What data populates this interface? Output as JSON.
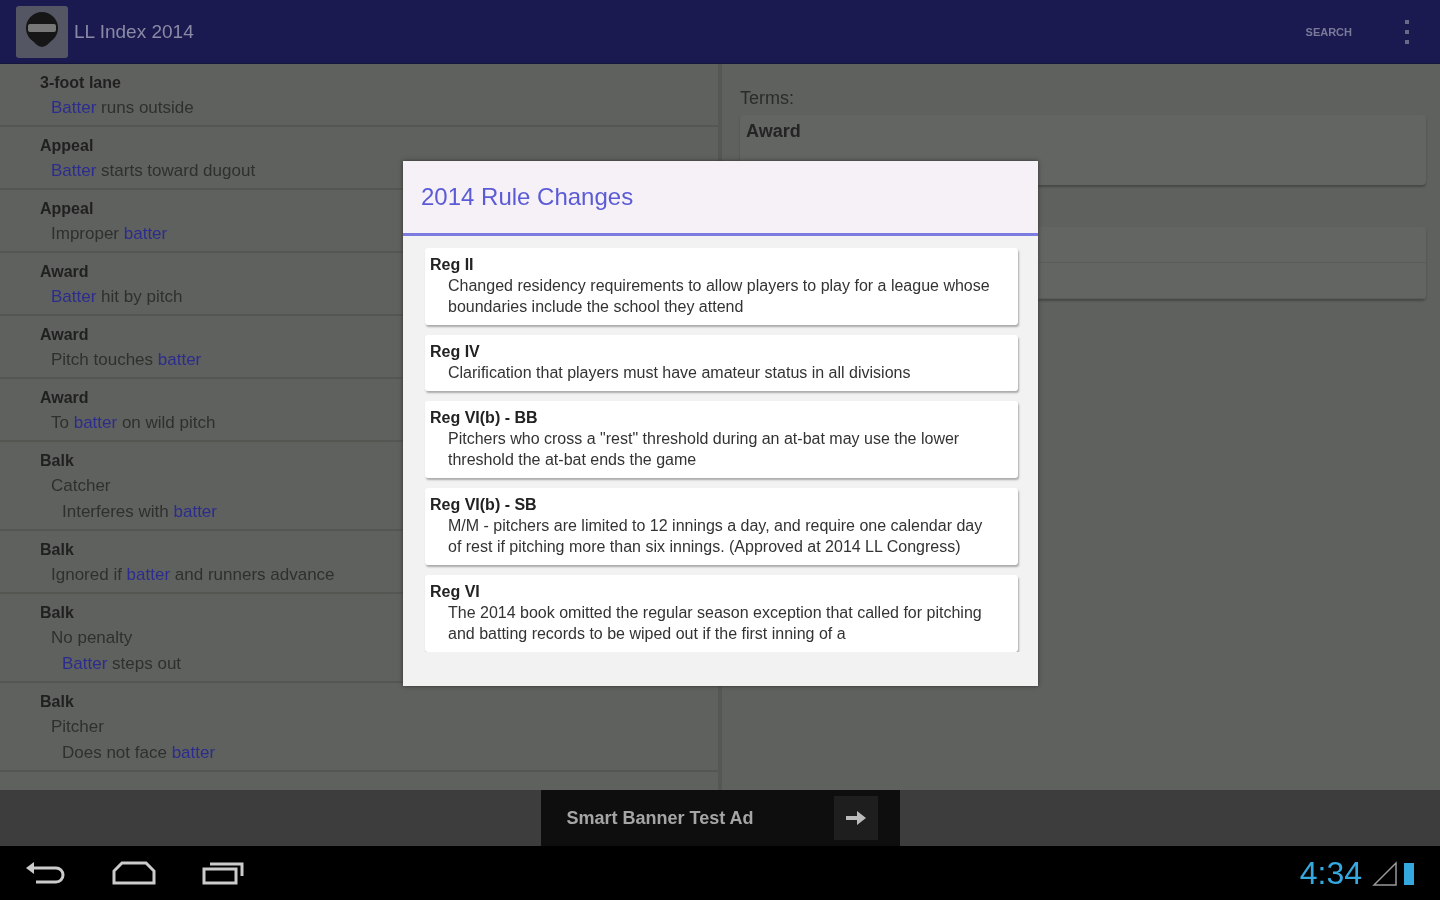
{
  "app_bar": {
    "title": "LL Index 2014",
    "actions": [
      {
        "kind": "text",
        "label": "SEARCH"
      },
      {
        "kind": "overflow"
      }
    ]
  },
  "index": [
    {
      "term": "3-foot lane",
      "children": [
        {
          "segments": [
            {
              "text": "Batter",
              "highlight": true
            },
            {
              "text": " runs outside",
              "highlight": false
            }
          ]
        }
      ]
    },
    {
      "term": "Appeal",
      "children": [
        {
          "segments": [
            {
              "text": "Batter",
              "highlight": true
            },
            {
              "text": " starts toward dugout",
              "highlight": false
            }
          ]
        }
      ]
    },
    {
      "term": "Appeal",
      "children": [
        {
          "segments": [
            {
              "text": "Improper ",
              "highlight": false
            },
            {
              "text": "batter",
              "highlight": true
            }
          ]
        }
      ]
    },
    {
      "term": "Award",
      "children": [
        {
          "segments": [
            {
              "text": "Batter",
              "highlight": true
            },
            {
              "text": " hit by pitch",
              "highlight": false
            }
          ]
        }
      ]
    },
    {
      "term": "Award",
      "children": [
        {
          "segments": [
            {
              "text": "Pitch touches ",
              "highlight": false
            },
            {
              "text": "batter",
              "highlight": true
            }
          ]
        }
      ]
    },
    {
      "term": "Award",
      "children": [
        {
          "segments": [
            {
              "text": "To ",
              "highlight": false
            },
            {
              "text": "batter",
              "highlight": true
            },
            {
              "text": " on wild pitch",
              "highlight": false
            }
          ]
        }
      ]
    },
    {
      "term": "Balk",
      "children": [
        {
          "segments": [
            {
              "text": "Catcher",
              "highlight": false
            }
          ],
          "children": [
            {
              "segments": [
                {
                  "text": "Interferes with ",
                  "highlight": false
                },
                {
                  "text": "batter",
                  "highlight": true
                }
              ]
            }
          ]
        }
      ]
    },
    {
      "term": "Balk",
      "children": [
        {
          "segments": [
            {
              "text": "Ignored if ",
              "highlight": false
            },
            {
              "text": "batter",
              "highlight": true
            },
            {
              "text": " and runners advance",
              "highlight": false
            }
          ]
        }
      ]
    },
    {
      "term": "Balk",
      "children": [
        {
          "segments": [
            {
              "text": "No penalty",
              "highlight": false
            }
          ],
          "children": [
            {
              "segments": [
                {
                  "text": "Batter",
                  "highlight": true
                },
                {
                  "text": " steps out",
                  "highlight": false
                }
              ]
            }
          ]
        }
      ]
    },
    {
      "term": "Balk",
      "children": [
        {
          "segments": [
            {
              "text": "Pitcher",
              "highlight": false
            }
          ],
          "children": [
            {
              "segments": [
                {
                  "text": "Does not face ",
                  "highlight": false
                },
                {
                  "text": "batter",
                  "highlight": true
                }
              ]
            }
          ]
        }
      ]
    }
  ],
  "search_panel": {
    "label": "Terms:",
    "terms_field": {
      "value": "Award"
    }
  },
  "dialog": {
    "title": "2014 Rule Changes",
    "items": [
      {
        "heading": "Reg II",
        "body": "Changed residency requirements to allow players to play for a league whose boundaries include the school they attend"
      },
      {
        "heading": "Reg IV",
        "body": "Clarification that players must have amateur status in all divisions"
      },
      {
        "heading": "Reg VI(b) - BB",
        "body": "Pitchers who cross a \"rest\" threshold during an at-bat may use the lower threshold the at-bat ends the game"
      },
      {
        "heading": "Reg VI(b) - SB",
        "body": "M/M - pitchers are limited to 12 innings a day, and require one calendar day of rest if pitching more than six innings. (Approved at 2014 LL Congress)"
      },
      {
        "heading": "Reg VI",
        "body": "The 2014 book omitted the regular season exception that called for pitching and batting records to be wiped out if the first inning of a"
      }
    ]
  },
  "ad_banner": {
    "text": "Smart Banner Test Ad"
  },
  "nav_bar": {
    "time": "4:34"
  }
}
